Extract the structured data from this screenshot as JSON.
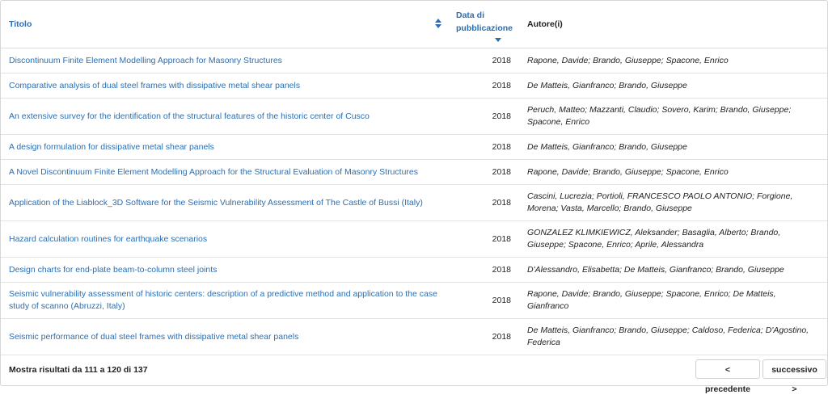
{
  "table": {
    "headers": {
      "title": "Titolo",
      "date": "Data di pubblicazione",
      "authors": "Autore(i)"
    },
    "rows": [
      {
        "title": "Discontinuum Finite Element Modelling Approach for Masonry Structures",
        "year": "2018",
        "authors": "Rapone, Davide; Brando, Giuseppe; Spacone, Enrico"
      },
      {
        "title": "Comparative analysis of dual steel frames with dissipative metal shear panels",
        "year": "2018",
        "authors": "De Matteis, Gianfranco; Brando, Giuseppe"
      },
      {
        "title": "An extensive survey for the identification of the structural features of the historic center of Cusco",
        "year": "2018",
        "authors": "Peruch, Matteo; Mazzanti, Claudio; Sovero, Karim; Brando, Giuseppe; Spacone, Enrico"
      },
      {
        "title": "A design formulation for dissipative metal shear panels",
        "year": "2018",
        "authors": "De Matteis, Gianfranco; Brando, Giuseppe"
      },
      {
        "title": "A Novel Discontinuum Finite Element Modelling Approach for the Structural Evaluation of Masonry Structures",
        "year": "2018",
        "authors": "Rapone, Davide; Brando, Giuseppe; Spacone, Enrico"
      },
      {
        "title": "Application of the Liablock_3D Software for the Seismic Vulnerability Assessment of The Castle of Bussi (Italy)",
        "year": "2018",
        "authors": "Cascini, Lucrezia; Portioli, FRANCESCO PAOLO ANTONIO; Forgione, Morena; Vasta, Marcello; Brando, Giuseppe"
      },
      {
        "title": "Hazard calculation routines for earthquake scenarios",
        "year": "2018",
        "authors": "GONZALEZ KLIMKIEWICZ, Aleksander; Basaglia, Alberto; Brando, Giuseppe; Spacone, Enrico; Aprile, Alessandra"
      },
      {
        "title": "Design charts for end-plate beam-to-column steel joints",
        "year": "2018",
        "authors": "D'Alessandro, Elisabetta; De Matteis, Gianfranco; Brando, Giuseppe"
      },
      {
        "title": "Seismic vulnerability assessment of historic centers: description of a predictive method and application to the case study of scanno (Abruzzi, Italy)",
        "year": "2018",
        "authors": "Rapone, Davide; Brando, Giuseppe; Spacone, Enrico; De Matteis, Gianfranco"
      },
      {
        "title": "Seismic performance of dual steel frames with dissipative metal shear panels",
        "year": "2018",
        "authors": "De Matteis, Gianfranco; Brando, Giuseppe; Caldoso, Federica; D'Agostino, Federica"
      }
    ]
  },
  "footer": {
    "summary": "Mostra risultati da 111 a 120 di 137",
    "prev_label": "< precedente",
    "next_label": "successivo >"
  },
  "colors": {
    "link": "#2a6fb5",
    "border": "#dcdcdc"
  },
  "icons": {
    "title_sort": "sort-both-icon",
    "date_sort": "sort-desc-icon"
  }
}
